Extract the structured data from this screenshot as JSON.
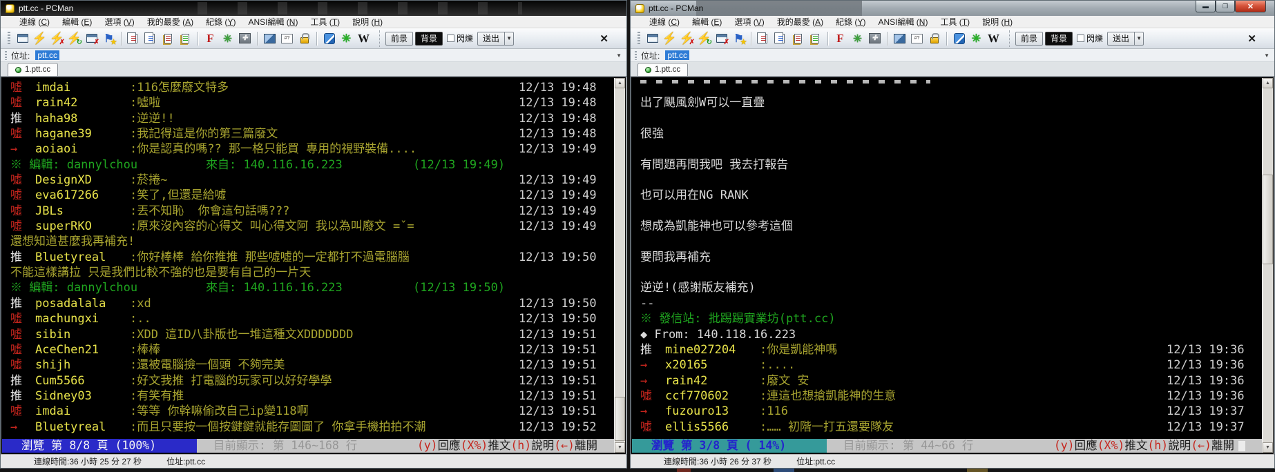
{
  "colors": {
    "terminal_bg": "#000000",
    "boo_red": "#c5251d",
    "push_white": "#e9e9e9",
    "user_yellow": "#e8e34a",
    "comment_olive": "#a8a430",
    "date_grey": "#cfcfcf",
    "system_green": "#1fa51f",
    "browse_blue_bg": "#2a2ac8",
    "browse_teal_bg": "#359a9a",
    "selection_blue": "#2f7cd6"
  },
  "toolbar_icons": [
    "session-window",
    "quick-connect",
    "disconnect",
    "reconnect",
    "close-session",
    "add-bookmark",
    "|",
    "copy",
    "copy-color",
    "paste",
    "paste-find",
    "|",
    "font",
    "settings",
    "fullscreen",
    "|",
    "split-view",
    "char-table",
    "lock",
    "|",
    "pcman-logo",
    "ptt-flower",
    "wikipedia"
  ],
  "left_window": {
    "title": "ptt.cc - PCMan",
    "menu": [
      "連線 (C)",
      "編輯 (E)",
      "選項 (V)",
      "我的最愛 (A)",
      "紀錄 (Y)",
      "ANSI編輯 (N)",
      "工具 (T)",
      "說明 (H)"
    ],
    "toolbar": {
      "fg": "前景",
      "bg": "背景",
      "blink": "閃爍",
      "send": "送出"
    },
    "address_label": "位址:",
    "address_value": "ptt.cc",
    "tab": "1.ptt.cc",
    "rows": [
      {
        "kind": "boo",
        "user": "imdai",
        "text": ":116怎麼廢文特多",
        "date": "12/13 19:48"
      },
      {
        "kind": "boo",
        "user": "rain42",
        "text": ":噓啦",
        "date": "12/13 19:48"
      },
      {
        "kind": "push",
        "user": "haha98",
        "text": ":逆逆!!",
        "date": "12/13 19:48"
      },
      {
        "kind": "boo",
        "user": "hagane39",
        "text": ":我記得這是你的第三篇廢文",
        "date": "12/13 19:48"
      },
      {
        "kind": "arrow",
        "user": "aoiaoi",
        "text": ":你是認真的嗎?? 那一格只能買 專用的視野裝備....",
        "date": "12/13 19:49"
      },
      {
        "kind": "edit",
        "a": "※ 編輯: dannylchou",
        "b": "來自: 140.116.16.223",
        "c": "(12/13 19:49)"
      },
      {
        "kind": "boo",
        "user": "DesignXD",
        "text": ":菸捲~",
        "date": "12/13 19:49"
      },
      {
        "kind": "boo",
        "user": "eva617266",
        "text": ":笑了,但還是給噓",
        "date": "12/13 19:49"
      },
      {
        "kind": "boo",
        "user": "JBLs",
        "text": ":丟不知恥  你會這句話嗎???",
        "date": "12/13 19:49"
      },
      {
        "kind": "boo",
        "user": "superRKO",
        "text": ":原來沒內容的心得文 叫心得文阿 我以為叫廢文 =ˇ=",
        "date": "12/13 19:49"
      },
      {
        "kind": "olive",
        "text": "還想知道甚麼我再補充!"
      },
      {
        "kind": "push",
        "user": "Bluetyreal",
        "text": ":你好棒棒 給你推推 那些噓噓的一定都打不過電腦腦",
        "date": "12/13 19:50"
      },
      {
        "kind": "olive",
        "text": "不能這樣講拉 只是我們比較不強的也是要有自己的一片天"
      },
      {
        "kind": "edit",
        "a": "※ 編輯: dannylchou",
        "b": "來自: 140.116.16.223",
        "c": "(12/13 19:50)"
      },
      {
        "kind": "push",
        "user": "posadalala",
        "text": ":xd",
        "date": "12/13 19:50"
      },
      {
        "kind": "boo",
        "user": "machungxi",
        "text": ":..",
        "date": "12/13 19:50"
      },
      {
        "kind": "boo",
        "user": "sibin",
        "text": ":XDD 這ID八卦版也一堆這種文XDDDDDDD",
        "date": "12/13 19:51"
      },
      {
        "kind": "boo",
        "user": "AceChen21",
        "text": ":棒棒",
        "date": "12/13 19:51"
      },
      {
        "kind": "boo",
        "user": "shijh",
        "text": ":還被電腦撿一個頭 不夠完美",
        "date": "12/13 19:51"
      },
      {
        "kind": "push",
        "user": "Cum5566",
        "text": ":好文我推 打電腦的玩家可以好好學學",
        "date": "12/13 19:51"
      },
      {
        "kind": "push",
        "user": "Sidney03",
        "text": ":有笑有推",
        "date": "12/13 19:51"
      },
      {
        "kind": "boo",
        "user": "imdai",
        "text": ":等等 你幹嘛偷改自己ip變118啊",
        "date": "12/13 19:51"
      },
      {
        "kind": "arrow",
        "user": "Bluetyreal",
        "text": ":而且只要按一個按鍵鍵就能存圖圖了 你拿手機拍拍不潮",
        "date": "12/13 19:52"
      }
    ],
    "browse": {
      "position": "瀏覽 第 8/8 頁 (100%)",
      "range": "目前顯示: 第 146~168 行",
      "keys": [
        {
          "k": "(y)",
          "t": "回應"
        },
        {
          "k": "(X%)",
          "t": "推文"
        },
        {
          "k": "(h)",
          "t": "說明"
        },
        {
          "k": "(←)",
          "t": "離開"
        }
      ]
    },
    "status_time": "連線時間:36 小時 25 分 27 秒",
    "status_addr": "位址:ptt.cc"
  },
  "right_window": {
    "title": "ptt.cc - PCMan",
    "menu": [
      "連線 (C)",
      "編輯 (E)",
      "選項 (V)",
      "我的最愛 (A)",
      "紀錄 (Y)",
      "ANSI編輯 (N)",
      "工具 (T)",
      "說明 (H)"
    ],
    "toolbar": {
      "fg": "前景",
      "bg": "背景",
      "blink": "閃爍",
      "send": "送出"
    },
    "address_label": "位址:",
    "address_value": "ptt.cc",
    "tab": "1.ptt.cc",
    "caption_icons": [
      "minimize",
      "maximize",
      "close"
    ],
    "rows": [
      {
        "kind": "sliver"
      },
      {
        "kind": "white",
        "text": "出了颶風劍W可以一直疊"
      },
      {
        "kind": "blank"
      },
      {
        "kind": "white",
        "text": "很強"
      },
      {
        "kind": "blank"
      },
      {
        "kind": "white",
        "text": "有問題再問我吧 我去打報告"
      },
      {
        "kind": "blank"
      },
      {
        "kind": "white",
        "text": "也可以用在NG RANK"
      },
      {
        "kind": "blank"
      },
      {
        "kind": "white",
        "text": "想成為凱能神也可以參考這個"
      },
      {
        "kind": "blank"
      },
      {
        "kind": "white",
        "text": "要問我再補充"
      },
      {
        "kind": "blank"
      },
      {
        "kind": "white",
        "text": "逆逆!(感謝版友補充)"
      },
      {
        "kind": "white",
        "text": "--"
      },
      {
        "kind": "green",
        "text": "※ 發信站: 批踢踢實業坊(ptt.cc)"
      },
      {
        "kind": "white",
        "text": "◆ From: 140.118.16.223"
      },
      {
        "kind": "push",
        "user": "mine027204",
        "text": ":你是凱能神嗎",
        "date": "12/13 19:36"
      },
      {
        "kind": "arrow",
        "user": "x20165",
        "text": ":....",
        "date": "12/13 19:36"
      },
      {
        "kind": "arrow",
        "user": "rain42",
        "text": ":廢文 安",
        "date": "12/13 19:36"
      },
      {
        "kind": "boo",
        "user": "ccf770602",
        "text": ":連這也想搶凱能神的生意",
        "date": "12/13 19:36"
      },
      {
        "kind": "arrow",
        "user": "fuzouro13",
        "text": ":116",
        "date": "12/13 19:37"
      },
      {
        "kind": "boo",
        "user": "ellis5566",
        "text": ":…… 初階一打五還要隊友",
        "date": "12/13 19:37"
      }
    ],
    "browse": {
      "position": "瀏覽 第 3/8 頁 ( 14%)",
      "range": "目前顯示: 第 44~66 行",
      "keys": [
        {
          "k": "(y)",
          "t": "回應"
        },
        {
          "k": "(X%)",
          "t": "推文"
        },
        {
          "k": "(h)",
          "t": "說明"
        },
        {
          "k": "(←)",
          "t": "離開"
        }
      ]
    },
    "status_time": "連線時間:36 小時 26 分 37 秒",
    "status_addr": "位址:ptt.cc"
  }
}
